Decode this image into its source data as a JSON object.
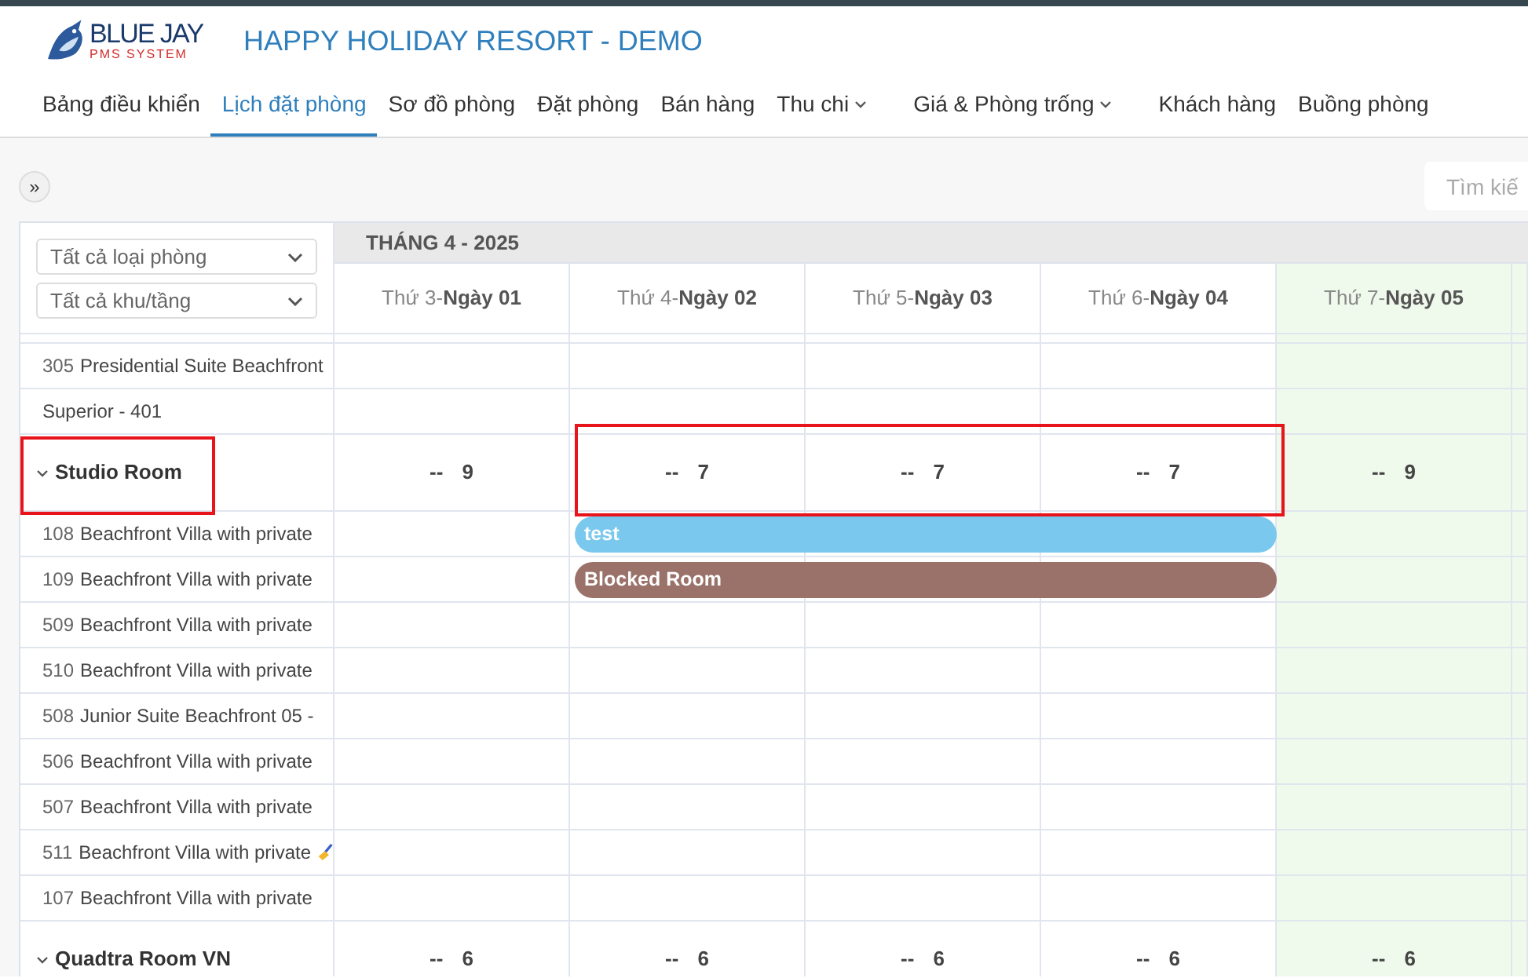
{
  "logo": {
    "name": "BLUE JAY",
    "subtitle": "PMS SYSTEM"
  },
  "title": "HAPPY HOLIDAY RESORT - DEMO",
  "nav": [
    {
      "label": "Bảng điều khiển",
      "selected": false,
      "dropdown": false
    },
    {
      "label": "Lịch đặt phòng",
      "selected": true,
      "dropdown": false
    },
    {
      "label": "Sơ đồ phòng",
      "selected": false,
      "dropdown": false
    },
    {
      "label": "Đặt phòng",
      "selected": false,
      "dropdown": false
    },
    {
      "label": "Bán hàng",
      "selected": false,
      "dropdown": false
    },
    {
      "label": "Thu chi",
      "selected": false,
      "dropdown": true
    },
    {
      "label": "Giá & Phòng trống",
      "selected": false,
      "dropdown": true
    },
    {
      "label": "Khách hàng",
      "selected": false,
      "dropdown": false
    },
    {
      "label": "Buồng phòng",
      "selected": false,
      "dropdown": false
    }
  ],
  "toolbar": {
    "toggle": "»",
    "search": {
      "placeholder": "Tìm kiế"
    }
  },
  "filters": [
    {
      "value": "Tất cả loại phòng"
    },
    {
      "value": "Tất cả khu/tầng"
    }
  ],
  "month": "THÁNG 4 - 2025",
  "days": [
    {
      "weekday": "Thứ 3-",
      "date": "Ngày 01",
      "weekend": false
    },
    {
      "weekday": "Thứ 4-",
      "date": "Ngày 02",
      "weekend": false
    },
    {
      "weekday": "Thứ 5-",
      "date": "Ngày 03",
      "weekend": false
    },
    {
      "weekday": "Thứ 6-",
      "date": "Ngày 04",
      "weekend": false
    },
    {
      "weekday": "Thứ 7-",
      "date": "Ngày 05",
      "weekend": true
    }
  ],
  "rows": [
    {
      "kind": "room",
      "name": "Presidential Suite Beachfront",
      "number": "305",
      "cleaning": false
    },
    {
      "kind": "room",
      "name": "Superior - 401",
      "cleaning": false
    },
    {
      "kind": "group",
      "name": "Studio Room",
      "expanded": true,
      "highlighted": true,
      "counts": [
        {
          "dash": "--",
          "value": "9",
          "highlighted": false
        },
        {
          "dash": "--",
          "value": "7",
          "highlighted": true
        },
        {
          "dash": "--",
          "value": "7",
          "highlighted": true
        },
        {
          "dash": "--",
          "value": "7",
          "highlighted": true
        },
        {
          "dash": "--",
          "value": "9",
          "highlighted": false
        }
      ]
    },
    {
      "kind": "room",
      "name": "Beachfront Villa with private",
      "number": "108",
      "cleaning": false,
      "booking": {
        "label": "test",
        "color": "#7ac8ee",
        "days": [
          false,
          true,
          true,
          true,
          false
        ]
      }
    },
    {
      "kind": "room",
      "name": "Beachfront Villa with private",
      "number": "109",
      "cleaning": false,
      "booking": {
        "label": "Blocked Room",
        "color": "#9a726a",
        "days": [
          false,
          true,
          true,
          true,
          false
        ]
      }
    },
    {
      "kind": "room",
      "name": "Beachfront Villa with private",
      "number": "509",
      "cleaning": false
    },
    {
      "kind": "room",
      "name": "Beachfront Villa with private",
      "number": "510",
      "cleaning": false
    },
    {
      "kind": "room",
      "name": "Junior Suite Beachfront 05 -",
      "number": "508",
      "cleaning": false
    },
    {
      "kind": "room",
      "name": "Beachfront Villa with private",
      "number": "506",
      "cleaning": false
    },
    {
      "kind": "room",
      "name": "Beachfront Villa with private",
      "number": "507",
      "cleaning": false
    },
    {
      "kind": "room",
      "name": "Beachfront Villa with private",
      "number": "511",
      "cleaning": true
    },
    {
      "kind": "room",
      "name": "Beachfront Villa with private",
      "number": "107",
      "cleaning": false
    },
    {
      "kind": "group",
      "name": "Quadtra Room VN",
      "expanded": true,
      "highlighted": false,
      "counts": [
        {
          "dash": "--",
          "value": "6",
          "highlighted": false
        },
        {
          "dash": "--",
          "value": "6",
          "highlighted": false
        },
        {
          "dash": "--",
          "value": "6",
          "highlighted": false
        },
        {
          "dash": "--",
          "value": "6",
          "highlighted": false
        },
        {
          "dash": "--",
          "value": "6",
          "highlighted": false
        }
      ]
    }
  ]
}
